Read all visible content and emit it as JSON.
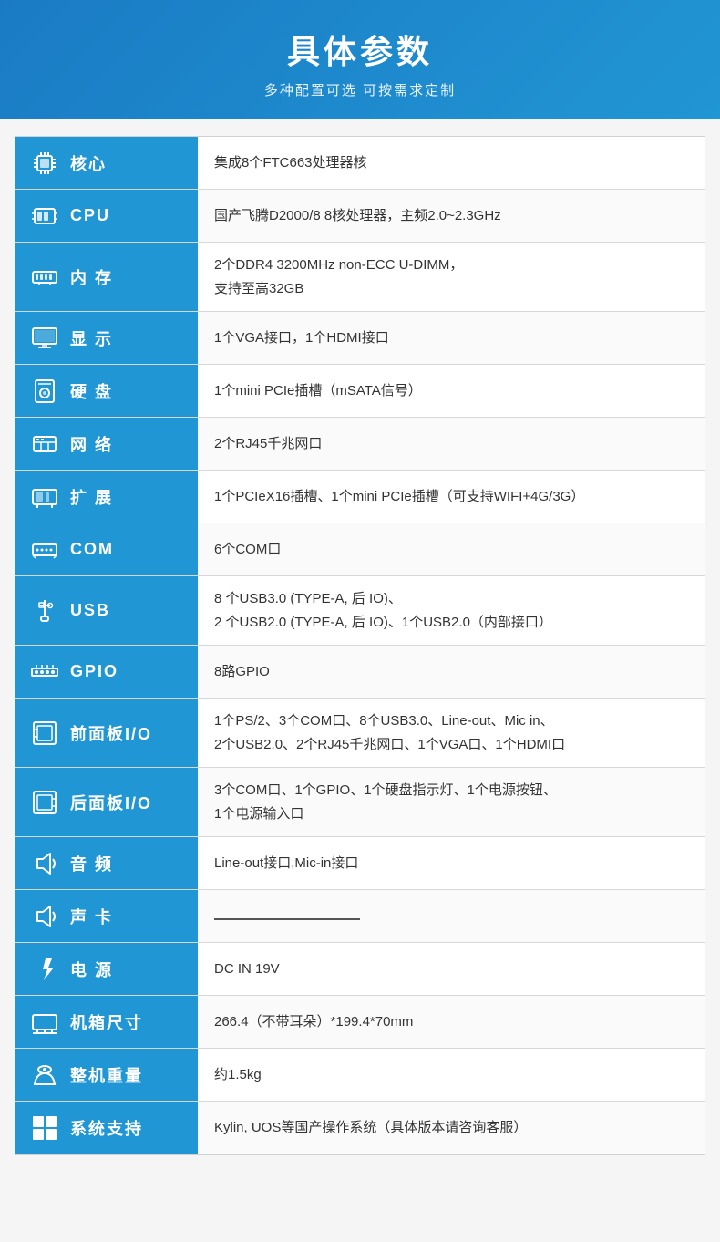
{
  "header": {
    "title": "具体参数",
    "subtitle": "多种配置可选 可按需求定制"
  },
  "rows": [
    {
      "id": "core",
      "label": "核心",
      "icon": "core",
      "value": "集成8个FTC663处理器核"
    },
    {
      "id": "cpu",
      "label": "CPU",
      "icon": "cpu",
      "value": "国产飞腾D2000/8  8核处理器，主频2.0~2.3GHz"
    },
    {
      "id": "memory",
      "label": "内 存",
      "icon": "mem",
      "value": "2个DDR4 3200MHz non-ECC U-DIMM，\n支持至高32GB"
    },
    {
      "id": "display",
      "label": "显 示",
      "icon": "display",
      "value": "1个VGA接口，1个HDMI接口"
    },
    {
      "id": "disk",
      "label": "硬 盘",
      "icon": "disk",
      "value": "1个mini PCIe插槽（mSATA信号）"
    },
    {
      "id": "network",
      "label": "网 络",
      "icon": "net",
      "value": "2个RJ45千兆网口"
    },
    {
      "id": "expand",
      "label": "扩 展",
      "icon": "expand",
      "value": "1个PCIeX16插槽、1个mini PCIe插槽（可支持WIFI+4G/3G）"
    },
    {
      "id": "com",
      "label": "COM",
      "icon": "com",
      "value": "6个COM口"
    },
    {
      "id": "usb",
      "label": "USB",
      "icon": "usb",
      "value": "8 个USB3.0 (TYPE-A, 后 IO)、\n2 个USB2.0 (TYPE-A, 后 IO)、1个USB2.0（内部接口）"
    },
    {
      "id": "gpio",
      "label": "GPIO",
      "icon": "gpio",
      "value": "8路GPIO"
    },
    {
      "id": "front-io",
      "label": "前面板I/O",
      "icon": "front",
      "value": "1个PS/2、3个COM口、8个USB3.0、Line-out、Mic in、\n2个USB2.0、2个RJ45千兆网口、1个VGA口、1个HDMI口"
    },
    {
      "id": "back-io",
      "label": "后面板I/O",
      "icon": "back",
      "value": "3个COM口、1个GPIO、1个硬盘指示灯、1个电源按钮、\n1个电源输入口"
    },
    {
      "id": "audio",
      "label": "音 频",
      "icon": "audio",
      "value": "Line-out接口,Mic-in接口"
    },
    {
      "id": "soundcard",
      "label": "声 卡",
      "icon": "soundcard",
      "value": "——————————"
    },
    {
      "id": "power",
      "label": "电 源",
      "icon": "power",
      "value": "DC IN 19V"
    },
    {
      "id": "size",
      "label": "机箱尺寸",
      "icon": "size",
      "value": "266.4（不带耳朵）*199.4*70mm"
    },
    {
      "id": "weight",
      "label": "整机重量",
      "icon": "weight",
      "value": "约1.5kg"
    },
    {
      "id": "os",
      "label": "系统支持",
      "icon": "os",
      "value": "Kylin, UOS等国产操作系统（具体版本请咨询客服）"
    }
  ]
}
